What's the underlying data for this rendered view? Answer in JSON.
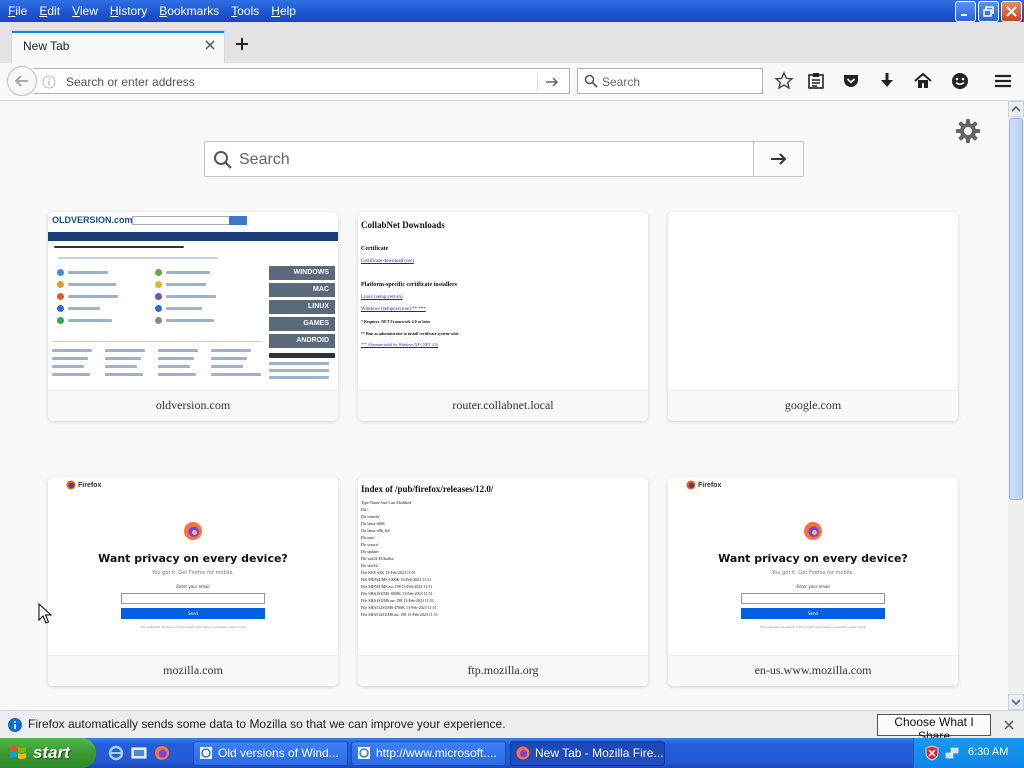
{
  "menu": {
    "items": [
      {
        "first": "F",
        "rest": "ile"
      },
      {
        "first": "E",
        "rest": "dit"
      },
      {
        "first": "V",
        "rest": "iew"
      },
      {
        "first": "H",
        "rest": "istory"
      },
      {
        "first": "B",
        "rest": "ookmarks"
      },
      {
        "first": "T",
        "rest": "ools"
      },
      {
        "first": "H",
        "rest": "elp"
      }
    ]
  },
  "tabs": [
    {
      "title": "New Tab"
    }
  ],
  "urlbar": {
    "placeholder": "Search or enter address"
  },
  "searchbar": {
    "placeholder": "Search"
  },
  "main_search": {
    "placeholder": "Search"
  },
  "tiles": [
    {
      "label": "oldversion.com",
      "thumb": {
        "logo": "OLDVERSION.com",
        "sidebar": [
          "WINDOWS",
          "MAC",
          "LINUX",
          "GAMES",
          "ANDROID"
        ]
      }
    },
    {
      "label": "router.collabnet.local",
      "thumb": {
        "heading": "CollabNet Downloads",
        "section1": "Certificate",
        "link1": "Certificate download (cer)",
        "section2": "Platform-specific certificate installers",
        "links": [
          "Linux (setup.cert.sh)",
          "Windows (setupcert.exe) ** ***",
          "* Requires .NET Framework 4.0 or later",
          "** Run as administrator to install certificate system-wide",
          "*** Alternate build for Windows XP (.NET 3.5)"
        ]
      }
    },
    {
      "label": "google.com"
    },
    {
      "label": "mozilla.com",
      "thumb": {
        "brand": "Firefox",
        "title": "Want privacy on every device?",
        "sub": "You got it. Get Firefox for mobile.",
        "field_label": "Enter your email",
        "button": "Send",
        "fine": "The intended recipient of the email must have consented. Learn more"
      }
    },
    {
      "label": "ftp.mozilla.org",
      "thumb": {
        "title": "Index of /pub/firefox/releases/12.0/",
        "header": "Type   Name        Size   Last Modified",
        "rows": [
          "Dir  ..",
          "Dir  contrib/",
          "Dir  linux-i686/",
          "Dir  linux-x86_64/",
          "Dir  mac/",
          "Dir  source/",
          "Dir  update/",
          "Dir  win32-EUballot/",
          "Dir  win32/",
          "File  KEY   63K   13-Feb-2023 11:51",
          "File  MD5SUMS   1000K   13-Feb-2023 11:51",
          "File  MD5SUMS.asc   198   13-Feb-2023 11:51",
          "File  SHA1SUMS   1000K   13-Feb-2023 11:51",
          "File  SHA1SUMS.asc   198   13-Feb-2023 11:51",
          "File  SHA512SUMS   4700K   13-Feb-2023 11:51",
          "File  SHA512SUMS.asc   198   13-Feb-2023 11:51"
        ]
      }
    },
    {
      "label": "en-us.www.mozilla.com",
      "thumb": {
        "brand": "Firefox",
        "title": "Want privacy on every device?",
        "sub": "You got it. Get Firefox for mobile.",
        "field_label": "Enter your email",
        "button": "Send",
        "fine": "The intended recipient of the email must have consented. Learn more"
      }
    }
  ],
  "notification": {
    "text": "Firefox automatically sends some data to Mozilla so that we can improve your experience.",
    "button": "Choose What I Share"
  },
  "taskbar": {
    "start": "start",
    "buttons": [
      {
        "title": "Old versions of Wind..."
      },
      {
        "title": "http://www.microsoft...."
      },
      {
        "title": "New Tab - Mozilla Fire..."
      }
    ],
    "clock": "6:30 AM"
  },
  "colors": {
    "accent": "#0a84ff",
    "xp_blue": "#245edb",
    "start_green": "#3a9a34",
    "firefox_blue": "#0060df"
  }
}
